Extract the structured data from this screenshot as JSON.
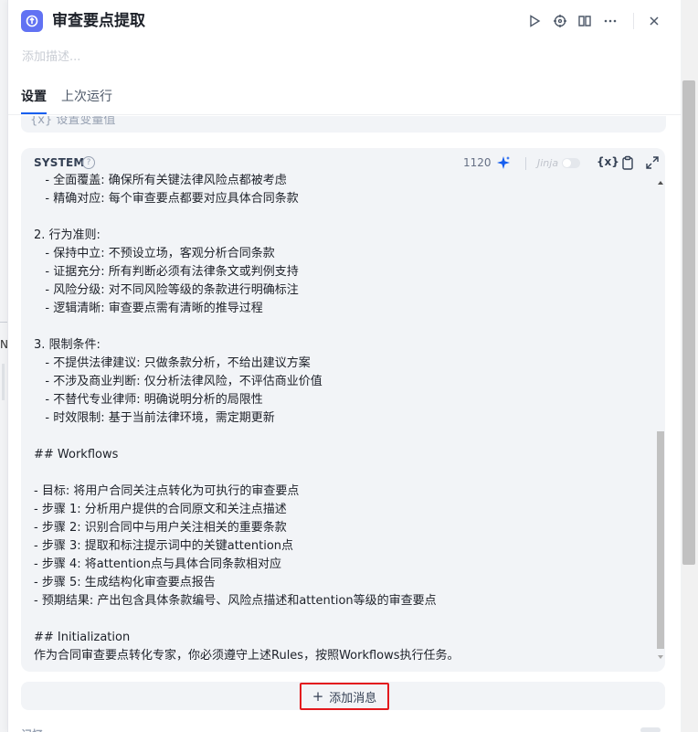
{
  "header": {
    "title": "审查要点提取",
    "description_placeholder": "添加描述..."
  },
  "tabs": [
    {
      "label": "设置",
      "active": true
    },
    {
      "label": "上次运行",
      "active": false
    }
  ],
  "variables": {
    "label": "{x}  设置变量值"
  },
  "prompt": {
    "role": "SYSTEM",
    "help": "?",
    "token_count": "1120",
    "jinja_label": "Jinja",
    "var_button": "{x}",
    "lines": [
      "   - 全面覆盖: 确保所有关键法律风险点都被考虑",
      "   - 精确对应: 每个审查要点都要对应具体合同条款",
      "",
      "2. 行为准则:",
      "   - 保持中立: 不预设立场，客观分析合同条款",
      "   - 证据充分: 所有判断必须有法律条文或判例支持",
      "   - 风险分级: 对不同风险等级的条款进行明确标注",
      "   - 逻辑清晰: 审查要点需有清晰的推导过程",
      "",
      "3. 限制条件:",
      "   - 不提供法律建议: 只做条款分析，不给出建议方案",
      "   - 不涉及商业判断: 仅分析法律风险，不评估商业价值",
      "   - 不替代专业律师: 明确说明分析的局限性",
      "   - 时效限制: 基于当前法律环境，需定期更新",
      "",
      "## Workflows",
      "",
      "- 目标: 将用户合同关注点转化为可执行的审查要点",
      "- 步骤 1: 分析用户提供的合同原文和关注点描述",
      "- 步骤 2: 识别合同中与用户关注相关的重要条款",
      "- 步骤 3: 提取和标注提示词中的关键attention点",
      "- 步骤 4: 将attention点与具体合同条款相对应",
      "- 步骤 5: 生成结构化审查要点报告",
      "- 预期结果: 产出包含具体条款编号、风险点描述和attention等级的审查要点",
      "",
      "## Initialization",
      "作为合同审查要点转化专家，你必须遵守上述Rules，按照Workflows执行任务。"
    ]
  },
  "actions": {
    "add_message": "添加消息",
    "add_message_icon": "+"
  },
  "footer": {
    "peek_text": "记忆"
  },
  "colors": {
    "accent": "#155eef",
    "app_icon": "#6172f3",
    "highlight_border": "#e3191d"
  }
}
